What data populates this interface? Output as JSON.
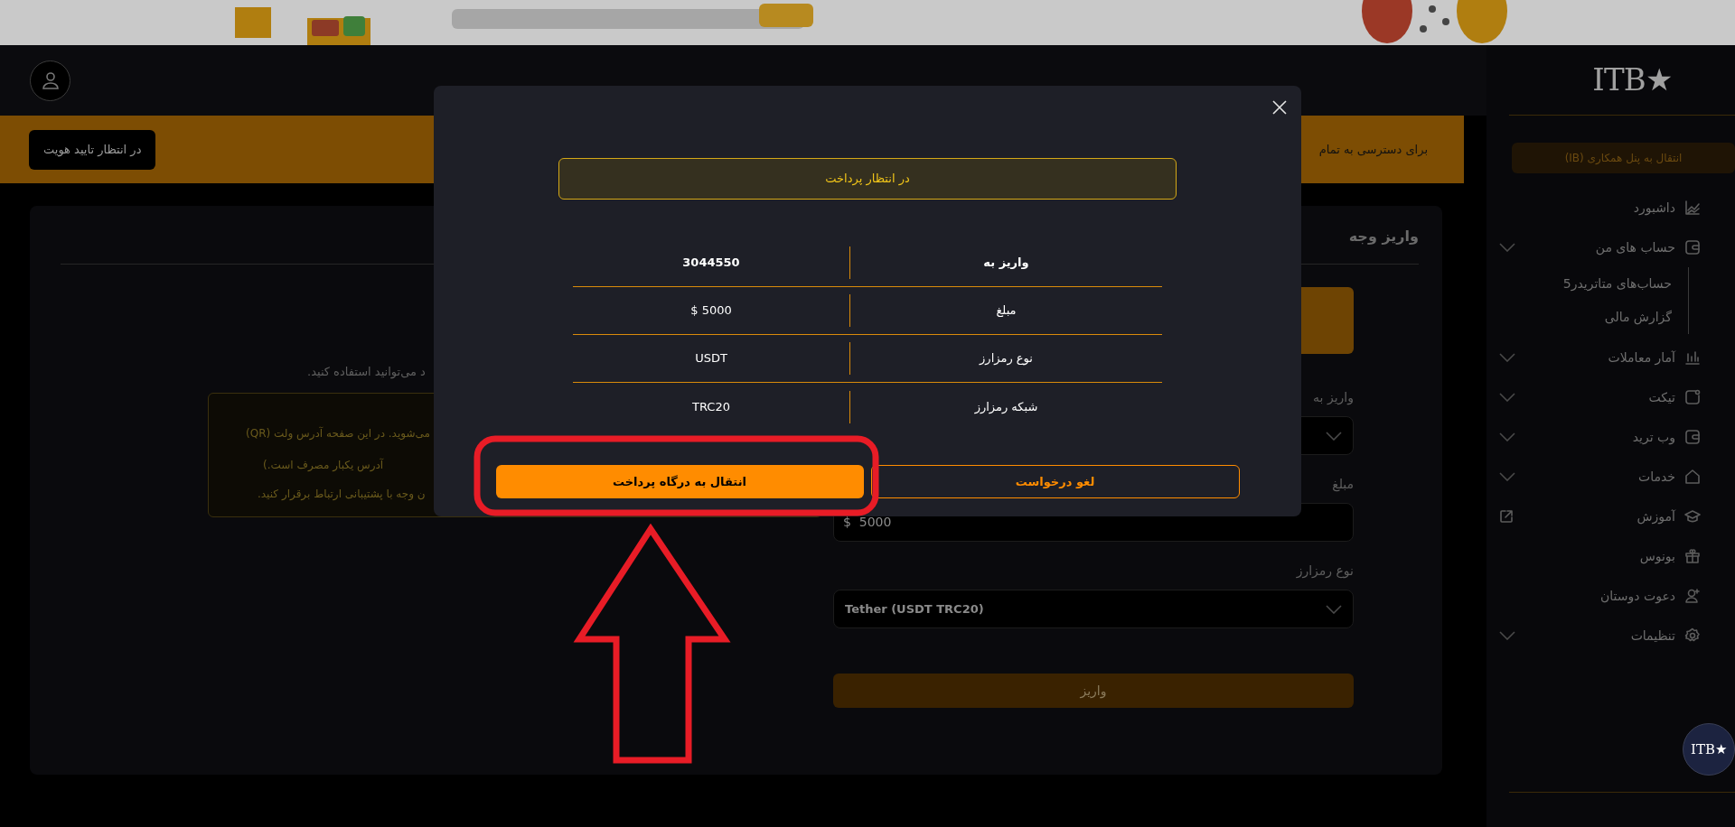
{
  "header": {
    "logo": "ITB★"
  },
  "notice_bar": {
    "text": "برای دسترسی به تمام",
    "button": "در انتظار تایید هویت"
  },
  "sidebar": {
    "ib_button": "انتقال به پنل همکاری (IB)",
    "items": [
      {
        "label": "داشبورد",
        "kind": "plain"
      },
      {
        "label": "حساب های من",
        "kind": "group",
        "children": [
          {
            "label": "حساب‌های متاتریدر5"
          },
          {
            "label": "گزارش مالی"
          }
        ]
      },
      {
        "label": "آمار معاملات",
        "kind": "group"
      },
      {
        "label": "تیکت",
        "kind": "group"
      },
      {
        "label": "وب ترید",
        "kind": "group"
      },
      {
        "label": "خدمات",
        "kind": "group"
      },
      {
        "label": "آموزش",
        "kind": "external"
      },
      {
        "label": "بونوس",
        "kind": "plain"
      },
      {
        "label": "دعوت دوستان",
        "kind": "plain"
      },
      {
        "label": "تنظیمات",
        "kind": "group"
      }
    ],
    "badge": "ITB★"
  },
  "content": {
    "title": "واریز وجه",
    "info_text": "د می‌توانید استفاده کنید.",
    "notice_lines": [
      "می‌شوید. در این صفحه آدرس ولت (QR)",
      "آدرس یکبار مصرف است.)",
      "ن وجه با پشتیبانی ارتباط برقرار کنید."
    ],
    "fields": [
      {
        "label": "واریز به",
        "kind": "select"
      },
      {
        "label": "مبلغ",
        "kind": "input",
        "prefix": "$",
        "value": "5000"
      },
      {
        "label": "نوع رمزارز",
        "kind": "select",
        "value": "Tether (USDT TRC20)"
      }
    ],
    "submit": "واریز"
  },
  "modal": {
    "status": "در انتظار پرداخت",
    "rows": [
      {
        "label": "واریز به",
        "value": "3044550",
        "bold": true
      },
      {
        "label": "مبلغ",
        "value": "$ 5000",
        "bold": false
      },
      {
        "label": "نوع رمزارز",
        "value": "USDT",
        "bold": false
      },
      {
        "label": "شبکه رمزارز",
        "value": "TRC20",
        "bold": false
      }
    ],
    "cancel_button": "لغو درخواست",
    "primary_button": "انتقال به درگاه پرداخت"
  }
}
